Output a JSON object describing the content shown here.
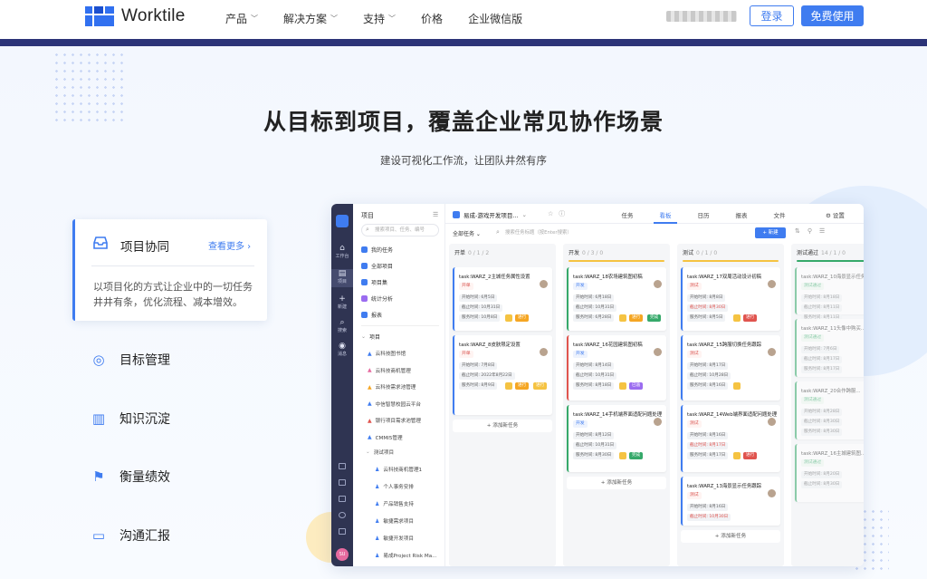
{
  "brand": {
    "name": "Worktile",
    "accent": "#3f7cf0",
    "dark": "#2c3478"
  },
  "nav": [
    {
      "label": "产品",
      "has_dropdown": true
    },
    {
      "label": "解决方案",
      "has_dropdown": true
    },
    {
      "label": "支持",
      "has_dropdown": true
    },
    {
      "label": "价格",
      "has_dropdown": false
    },
    {
      "label": "企业微信版",
      "has_dropdown": false
    }
  ],
  "header": {
    "login": "登录",
    "free": "免费使用"
  },
  "hero": {
    "title": "从目标到项目，覆盖企业常见协作场景",
    "subtitle": "建设可视化工作流，让团队井然有序"
  },
  "features": {
    "active": {
      "title": "项目协同",
      "more": "查看更多 ›",
      "desc": "以项目化的方式让企业中的一切任务井井有条，优化流程、减本增效。"
    },
    "items": [
      {
        "label": "目标管理",
        "icon": "target-icon"
      },
      {
        "label": "知识沉淀",
        "icon": "book-icon"
      },
      {
        "label": "衡量绩效",
        "icon": "flag-icon"
      },
      {
        "label": "沟通汇报",
        "icon": "chat-icon"
      }
    ]
  },
  "app": {
    "rail": [
      {
        "label": "工作台",
        "glyph": "⌂"
      },
      {
        "label": "项目",
        "glyph": "▤"
      },
      {
        "label": "新建",
        "glyph": "+"
      },
      {
        "label": "搜索",
        "glyph": "⌕"
      },
      {
        "label": "消息",
        "glyph": "◉"
      }
    ],
    "avatar": "SU",
    "side": {
      "title": "项目",
      "search": "搜索项目、任务、编号",
      "items": [
        "我的任务",
        "全部项目",
        "项目集",
        "统计分析",
        "报表"
      ],
      "group": "项目",
      "projects": [
        "云科技图书馆",
        "云科技商机管理",
        "云科技需求池管理",
        "中信智慧校园云平台",
        "银行项目需求池管理",
        "CMMI5管理"
      ],
      "subgroup": "测试项目",
      "subprojects": [
        "云科技商机管理1",
        "个人事务安排",
        "产品销售支持",
        "敏捷需求项目",
        "敏捷开发项目",
        "易成Project Risk Ma..."
      ]
    },
    "header": {
      "project": "易成-游戏开发项目...",
      "tabs": [
        "任务",
        "看板",
        "日历",
        "报表",
        "文件"
      ],
      "active_tab": "看板",
      "settings": "设置"
    },
    "toolbar": {
      "filter": "全部任务",
      "search": "搜索任务标题（按Enter搜索）",
      "new": "+ 新建"
    },
    "columns": [
      {
        "name": "开单",
        "count": "0 / 1 / 2",
        "bar": "#f5f6f8",
        "cards": [
          {
            "title": "task:WARZ_2主城任务属性设置",
            "status": "开单",
            "scls": "",
            "start": "开始时间: 6月5日",
            "end": "截止时间: 10月31日",
            "est": "服务时间: 10月8日",
            "tags": [
              {
                "t": "",
                "c": "#f5c342"
              },
              {
                "t": "进行",
                "c": "#f5a623"
              }
            ]
          },
          {
            "title": "task:WARZ_8皮肤限定设置",
            "status": "开单",
            "scls": "",
            "start": "开始时间: 7月8日",
            "end": "截止时间: 2022年8月22日",
            "est": "服务时间: 8月9日",
            "tags": [
              {
                "t": "",
                "c": "#f5c342"
              },
              {
                "t": "进行",
                "c": "#f5a623"
              },
              {
                "t": "进行",
                "c": "#f5c342"
              }
            ]
          }
        ],
        "add": "+ 添加新任务"
      },
      {
        "name": "开发",
        "count": "0 / 3 / 0",
        "bar": "#f5c342",
        "cards": [
          {
            "title": "task:WARZ_18农场建筑图初稿",
            "status": "开发",
            "scls": "blue",
            "start": "开始时间: 6月18日",
            "end": "截止时间: 10月31日",
            "est": "服务时间: 6月28日",
            "tags": [
              {
                "t": "",
                "c": "#f5c342"
              },
              {
                "t": "进行",
                "c": "#f5a623"
              },
              {
                "t": "完成",
                "c": "#36a96a"
              }
            ]
          },
          {
            "title": "task:WARZ_16花园建筑图初稿",
            "status": "开发",
            "scls": "blue",
            "start": "开始时间: 8月14日",
            "end": "截止时间: 10月31日",
            "est": "服务时间: 8月18日",
            "tags": [
              {
                "t": "",
                "c": "#f5c342"
              },
              {
                "t": "已逾",
                "c": "#9b6cf0"
              }
            ]
          },
          {
            "title": "task:WARZ_14手机端界面适配问题处理",
            "status": "开发",
            "scls": "blue",
            "start": "开始时间: 8月12日",
            "end": "截止时间: 10月31日",
            "est": "服务时间: 8月30日",
            "tags": [
              {
                "t": "",
                "c": "#f5c342"
              },
              {
                "t": "完成",
                "c": "#36a96a"
              }
            ]
          }
        ],
        "add": "+ 添加新任务"
      },
      {
        "name": "测试",
        "count": "0 / 1 / 0",
        "bar": "#f5c342",
        "cards": [
          {
            "title": "task:WARZ_17双周活动设计初稿",
            "status": "测试",
            "scls": "",
            "start": "开始时间: 8月8日",
            "end": "截止时间: 8月30日",
            "est": "服务时间: 8月5日",
            "tags": [
              {
                "t": "",
                "c": "#f5c342"
              },
              {
                "t": "进行",
                "c": "#e0544e"
              }
            ]
          },
          {
            "title": "task:WARZ_15跨服切换任务跟踪",
            "status": "测试",
            "scls": "",
            "start": "开始时间: 8月17日",
            "end": "截止时间: 10月28日",
            "est": "服务时间: 8月16日",
            "tags": [
              {
                "t": "",
                "c": "#f5c342"
              }
            ]
          },
          {
            "title": "task:WARZ_14Web端界面适配问题处理",
            "status": "测试",
            "scls": "",
            "start": "开始时间: 8月16日",
            "end": "截止时间: 8月17日",
            "est": "服务时间: 8月17日",
            "tags": [
              {
                "t": "",
                "c": "#f5c342"
              },
              {
                "t": "进行",
                "c": "#e0544e"
              }
            ]
          },
          {
            "title": "task:WARZ_13海景显示任务跟踪",
            "status": "测试",
            "scls": "",
            "start": "开始时间: 8月16日",
            "end": "截止时间: 10月30日",
            "est": "",
            "tags": []
          }
        ],
        "add": "+ 添加新任务"
      },
      {
        "name": "测试通过",
        "count": "14 / 1 / 0",
        "bar": "#36a96a",
        "cards": [
          {
            "title": "task:WARZ_10海景显示任务...",
            "status": "测试通过",
            "scls": "green",
            "start": "开始时间: 8月18日",
            "end": "截止时间: 8月11日",
            "est": "服务时间: 8月11日",
            "tags": []
          },
          {
            "title": "task:WARZ_11头像中购买...",
            "status": "测试通过",
            "scls": "green",
            "start": "开始时间: 7月6日",
            "end": "截止时间: 8月17日",
            "est": "服务时间: 8月17日",
            "tags": []
          },
          {
            "title": "task:WARZ_20合作跨服...",
            "status": "测试通过",
            "scls": "green",
            "start": "开始时间: 8月28日",
            "end": "截止时间: 8月30日",
            "est": "服务时间: 8月30日",
            "tags": []
          },
          {
            "title": "task:WARZ_16主城建筑图...",
            "status": "测试通过",
            "scls": "green",
            "start": "开始时间: 8月20日",
            "end": "截止时间: 8月30日",
            "est": "",
            "tags": []
          }
        ],
        "add": "+ 添加新任务"
      }
    ]
  }
}
